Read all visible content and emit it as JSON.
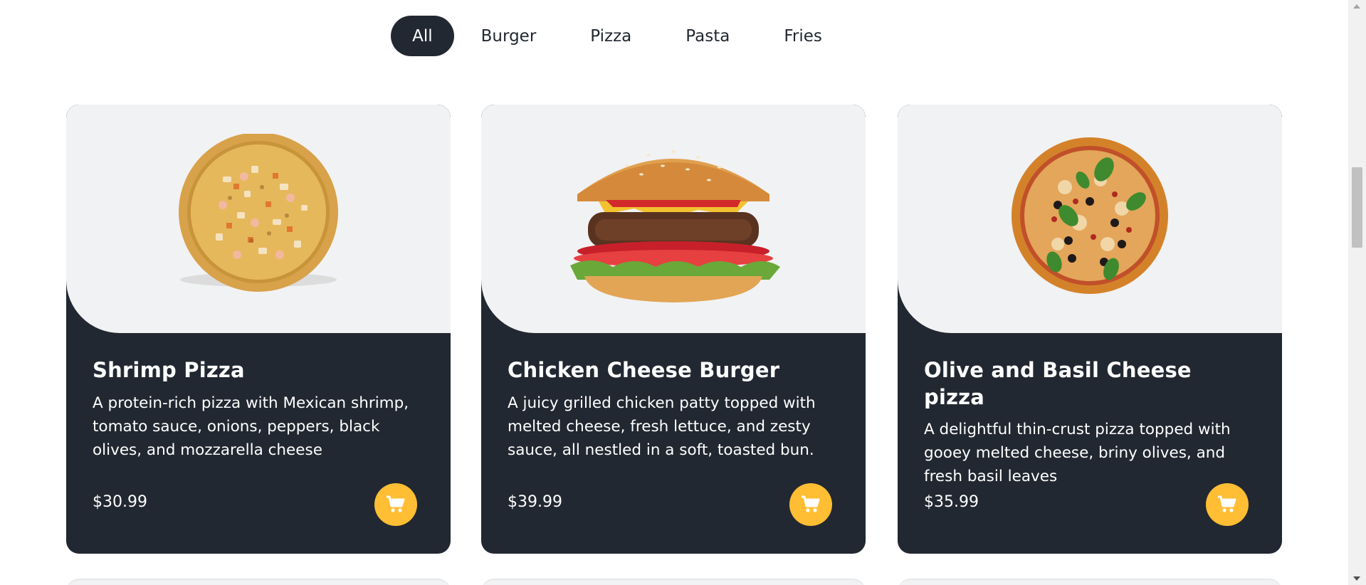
{
  "filters": [
    {
      "label": "All",
      "active": true
    },
    {
      "label": "Burger",
      "active": false
    },
    {
      "label": "Pizza",
      "active": false
    },
    {
      "label": "Pasta",
      "active": false
    },
    {
      "label": "Fries",
      "active": false
    }
  ],
  "cards": [
    {
      "title": "Shrimp Pizza",
      "description": "A protein-rich pizza with Mexican shrimp, tomato sauce, onions, peppers, black olives, and mozzarella cheese",
      "price": "$30.99",
      "image": "shrimp-pizza-image",
      "cart_icon": "cart-icon"
    },
    {
      "title": "Chicken Cheese Burger",
      "description": "A juicy grilled chicken patty topped with melted cheese, fresh lettuce, and zesty sauce, all nestled in a soft, toasted bun.",
      "price": "$39.99",
      "image": "burger-image",
      "cart_icon": "cart-icon"
    },
    {
      "title": "Olive and Basil Cheese pizza",
      "description": "A delightful thin-crust pizza topped with gooey melted cheese, briny olives, and fresh basil leaves",
      "price": "$35.99",
      "image": "olive-basil-pizza-image",
      "cart_icon": "cart-icon"
    }
  ],
  "colors": {
    "card_bg": "#222831",
    "image_bg": "#f1f2f3",
    "accent": "#ffbe33",
    "active_tab_bg": "#222831"
  }
}
